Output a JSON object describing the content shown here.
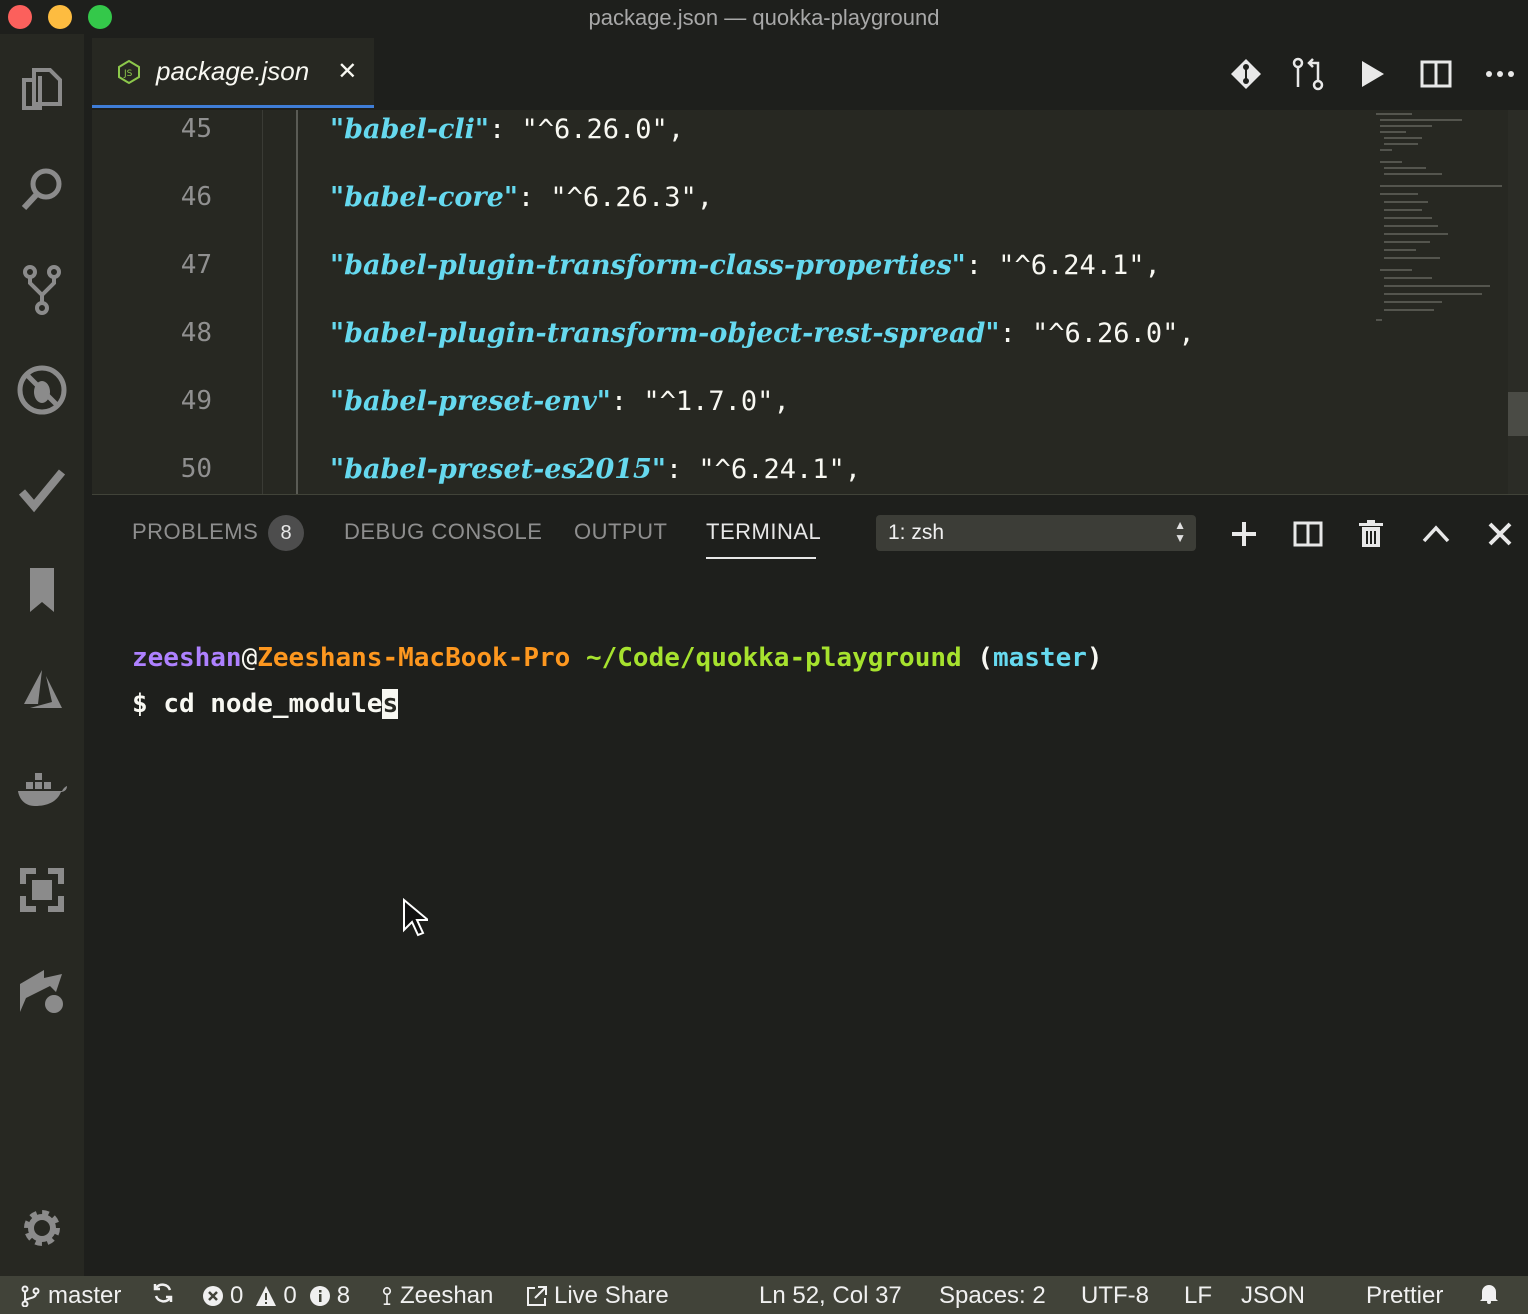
{
  "window": {
    "title": "package.json — quokka-playground"
  },
  "tab": {
    "label": "package.json",
    "close": "✕"
  },
  "editor": {
    "lines": [
      {
        "num": "45",
        "key": "\"babel-cli\"",
        "value": "\"^6.26.0\""
      },
      {
        "num": "46",
        "key": "\"babel-core\"",
        "value": "\"^6.26.3\""
      },
      {
        "num": "47",
        "key": "\"babel-plugin-transform-class-properties\"",
        "value": "\"^6.24.1\""
      },
      {
        "num": "48",
        "key": "\"babel-plugin-transform-object-rest-spread\"",
        "value": "\"^6.26.0\""
      },
      {
        "num": "49",
        "key": "\"babel-preset-env\"",
        "value": "\"^1.7.0\""
      },
      {
        "num": "50",
        "key": "\"babel-preset-es2015\"",
        "value": "\"^6.24.1\""
      }
    ]
  },
  "panel": {
    "tabs": [
      "PROBLEMS",
      "DEBUG CONSOLE",
      "OUTPUT",
      "TERMINAL"
    ],
    "problems_count": "8",
    "terminal_select": "1: zsh"
  },
  "terminal": {
    "user": "zeeshan",
    "at": "@",
    "host": "Zeeshans-MacBook-Pro",
    "path": "~/Code/quokka-playground",
    "paren_open": "(",
    "branch": "master",
    "paren_close": ")",
    "prompt": "$ ",
    "command": "cd node_module",
    "cursor_char": "s"
  },
  "status": {
    "branch": "master",
    "errors": "0",
    "warnings": "0",
    "infos": "8",
    "user": "Zeeshan",
    "live_share": "Live Share",
    "position": "Ln 52, Col 37",
    "spaces": "Spaces: 2",
    "encoding": "UTF-8",
    "eol": "LF",
    "language": "JSON",
    "formatter": "Prettier"
  },
  "colors": {
    "editor_bg": "#272822",
    "json_key": "#66d9ef",
    "terminal_user": "#ae81ff",
    "terminal_host": "#fd971f",
    "terminal_path": "#a6e22e",
    "status_bg": "#414339"
  }
}
